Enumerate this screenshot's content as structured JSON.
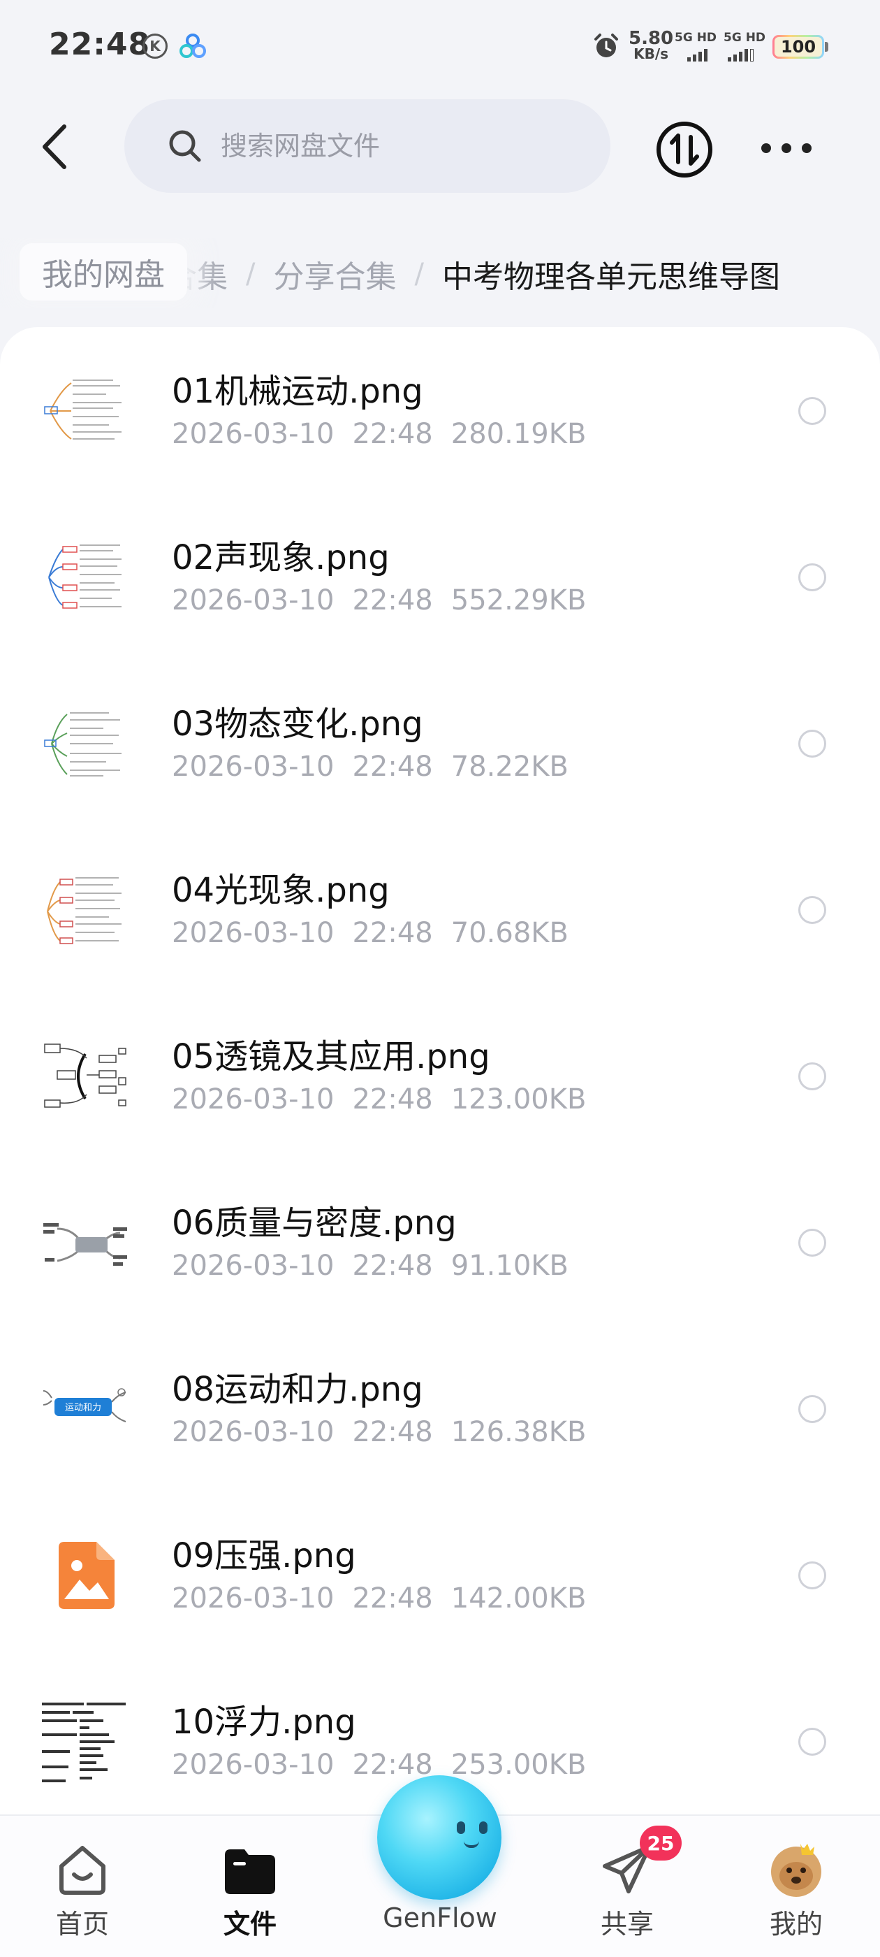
{
  "status_bar": {
    "time": "22:48",
    "net_speed_value": "5.80",
    "net_speed_unit": "KB/s",
    "sim1_label": "5G HD",
    "sim2_label": "5G HD",
    "battery": "100"
  },
  "header": {
    "search_placeholder": "搜索网盘文件"
  },
  "breadcrumb": {
    "home": "我的网盘",
    "hidden_part": "合集",
    "items": [
      "分享合集",
      "中考物理各单元思维导图"
    ],
    "separator": "/"
  },
  "files": [
    {
      "name": "01机械运动.png",
      "date": "2026-03-10",
      "time": "22:48",
      "size": "280.19KB"
    },
    {
      "name": "02声现象.png",
      "date": "2026-03-10",
      "time": "22:48",
      "size": "552.29KB"
    },
    {
      "name": "03物态变化.png",
      "date": "2026-03-10",
      "time": "22:48",
      "size": "78.22KB"
    },
    {
      "name": "04光现象.png",
      "date": "2026-03-10",
      "time": "22:48",
      "size": "70.68KB"
    },
    {
      "name": "05透镜及其应用.png",
      "date": "2026-03-10",
      "time": "22:48",
      "size": "123.00KB"
    },
    {
      "name": "06质量与密度.png",
      "date": "2026-03-10",
      "time": "22:48",
      "size": "91.10KB"
    },
    {
      "name": "08运动和力.png",
      "date": "2026-03-10",
      "time": "22:48",
      "size": "126.38KB"
    },
    {
      "name": "09压强.png",
      "date": "2026-03-10",
      "time": "22:48",
      "size": "142.00KB"
    },
    {
      "name": "10浮力.png",
      "date": "2026-03-10",
      "time": "22:48",
      "size": "253.00KB"
    }
  ],
  "thumb_text": {
    "f08": "运动和力"
  },
  "bottom_nav": {
    "home": "首页",
    "files": "文件",
    "genflow": "GenFlow",
    "share": "共享",
    "share_badge": "25",
    "me": "我的"
  },
  "colors": {
    "accent_orange": "#f5843a",
    "badge_red": "#f2325a",
    "genflow_blue": "#23b7e8",
    "thumb_blue": "#1f7fd6"
  }
}
